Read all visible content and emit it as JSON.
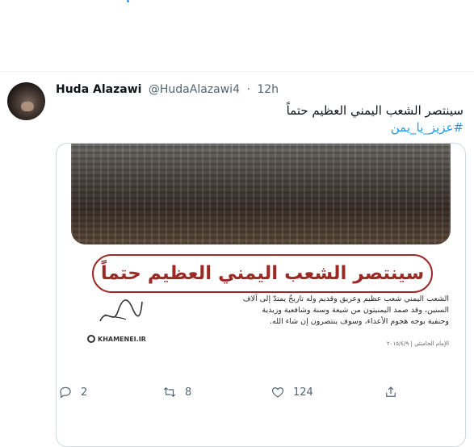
{
  "tweet": {
    "author_name": "Huda Alazawi",
    "handle": "@HudaAlazawi4",
    "separator": "·",
    "time": "12h",
    "text": "سينتصر الشعب اليمني العظيم حتماً",
    "hashtag": "#عزيز_يا_يمن"
  },
  "media": {
    "headline": "سينتصر الشعب اليمني العظيم حتماً",
    "quote": "الشعب اليمني شعب عظيم وعريق وقديم وله تاريخٌ يمتدّ إلى آلاف السنين، وقد صمد اليمنيتون من شيعة وسنة وشافعية وزيدية وحنفية بوجه هجوم الأعداء، وسوف ينتصرون إن شاء الله.",
    "attribution": "الإمام الخامنئي | ٢٠١٥/٤/٩",
    "logo_text": "KHAMENEI.IR"
  },
  "actions": {
    "reply_icon": "reply-icon",
    "reply_count": "2",
    "retweet_icon": "retweet-icon",
    "retweet_count": "8",
    "like_icon": "heart-icon",
    "like_count": "124",
    "share_icon": "share-icon"
  },
  "colors": {
    "link": "#1d9bf0",
    "banner": "#9b2a26",
    "muted": "#536471"
  }
}
